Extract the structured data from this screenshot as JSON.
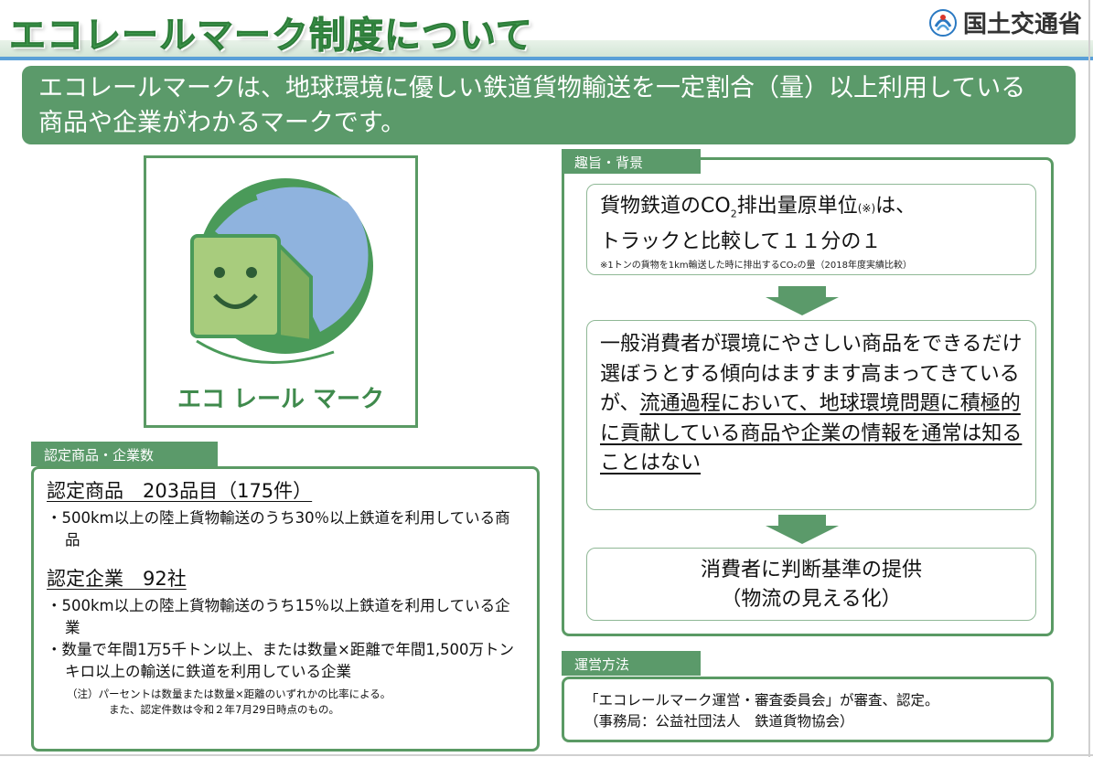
{
  "header": {
    "title": "エコレールマーク制度について",
    "ministry_name": "国土交通省",
    "accent_color": "#3f9a4e",
    "line_color": "#5aa0d8"
  },
  "banner": {
    "line1": "エコレールマークは、地球環境に優しい鉄道貨物輸送を一定割合（量）以上利用している",
    "line2": "商品や企業がわかるマークです。"
  },
  "logo": {
    "caption": "エコ レール マーク"
  },
  "certified": {
    "tab_label": "認定商品・企業数",
    "products_heading": "認定商品　203品目（175件）",
    "products_items": [
      "・500km以上の陸上貨物輸送のうち30％以上鉄道を利用している商品"
    ],
    "companies_heading": "認定企業　92社",
    "companies_items": [
      "・500km以上の陸上貨物輸送のうち15％以上鉄道を利用している企業",
      "・数量で年間1万5千トン以上、または数量×距離で年間1,500万トンキロ以上の輸送に鉄道を利用している企業"
    ],
    "note_line1": "（注）パーセントは数量または数量×距離のいずれかの比率による。",
    "note_line2": "また、認定件数は令和２年7月29日時点のもの。"
  },
  "background": {
    "tab_label": "趣旨・背景",
    "bubble1_part1": "貨物鉄道のCO",
    "bubble1_sub": "2",
    "bubble1_part2": "排出量原単位",
    "bubble1_mark": "(※)",
    "bubble1_part3": "は、",
    "bubble1_line2": "トラックと比較して１１分の１",
    "bubble1_note": "※1トンの貨物を1km輸送した時に排出するCO₂の量（2018年度実績比較）",
    "bubble2_plain1": "一般消費者が環境にやさしい商品をできるだけ選ぼうとする傾向はますます高まってきているが、",
    "bubble2_underlined": "流通過程において、地球環境問題に積極的に貢献している商品や企業の情報を通常は知ることはない",
    "bubble3_line1": "消費者に判断基準の提供",
    "bubble3_line2": "（物流の見える化）"
  },
  "operation": {
    "tab_label": "運営方法",
    "line1": "「エコレールマーク運営・審査委員会」が審査、認定。",
    "line2": "（事務局：公益社団法人　鉄道貨物協会）"
  }
}
